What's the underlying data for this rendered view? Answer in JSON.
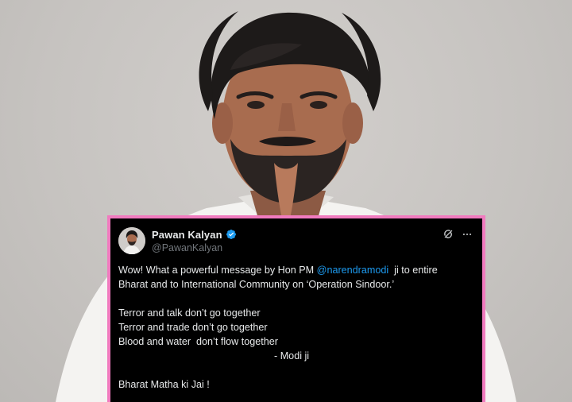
{
  "tweet": {
    "display_name": "Pawan Kalyan",
    "handle": "@PawanKalyan",
    "verified_icon": "verified-badge-icon",
    "actions": {
      "grok_icon": "grok-icon",
      "more_icon": "more-options-icon"
    },
    "body": {
      "line1_prefix": "Wow! What a powerful message by Hon PM ",
      "mention": "@narendramodi",
      "line1_suffix": "  ji to entire",
      "line2": "Bharat and to International Community on ‘Operation Sindoor.’",
      "quotes": [
        "Terror and talk don’t go together",
        "Terror and trade don’t go together",
        "Blood and water  don’t flow together"
      ],
      "attribution": "- Modi ji",
      "closing": "Bharat Matha ki Jai !"
    }
  },
  "colors": {
    "frame_border": "#f07bbf",
    "tweet_background": "#000000",
    "text": "#e7e9ea",
    "handle": "#71767b",
    "mention": "#1d9bf0",
    "background": "#c9c6c3"
  }
}
